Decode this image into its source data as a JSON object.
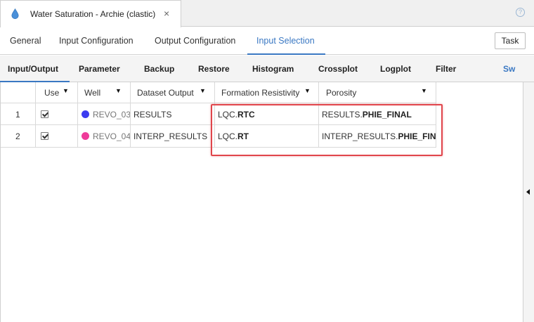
{
  "window": {
    "title": "Water Saturation - Archie (clastic)",
    "close_glyph": "×",
    "help_glyph": "?"
  },
  "main_tabs": [
    {
      "label": "General"
    },
    {
      "label": "Input Configuration"
    },
    {
      "label": "Output Configuration"
    },
    {
      "label": "Input Selection",
      "active": true
    }
  ],
  "task_button": "Task",
  "sub_tabs": [
    {
      "label": "Input/Output",
      "active": true
    },
    {
      "label": "Parameter"
    },
    {
      "label": "Backup"
    },
    {
      "label": "Restore"
    },
    {
      "label": "Histogram"
    },
    {
      "label": "Crossplot"
    },
    {
      "label": "Logplot"
    },
    {
      "label": "Filter"
    },
    {
      "label": "Sw"
    }
  ],
  "table": {
    "headers": {
      "use": "Use",
      "well": "Well",
      "dataset_output": "Dataset Output",
      "formation_resistivity": "Formation Resistivity",
      "porosity": "Porosity"
    },
    "rows": [
      {
        "index": "1",
        "use": true,
        "well": "REVO_03",
        "well_color": "#3c3cf0",
        "dataset_output": "RESULTS",
        "resistivity_prefix": "LQC.",
        "resistivity_curve": "RTC",
        "porosity_prefix": "RESULTS.",
        "porosity_curve": "PHIE_FINAL"
      },
      {
        "index": "2",
        "use": true,
        "well": "REVO_04",
        "well_color": "#ef3b9a",
        "dataset_output": "INTERP_RESULTS",
        "resistivity_prefix": "LQC.",
        "resistivity_curve": "RT",
        "porosity_prefix": "INTERP_RESULTS.",
        "porosity_curve": "PHIE_FINAL"
      }
    ]
  },
  "colors": {
    "accent": "#3a78c3",
    "highlight": "#e0454b"
  },
  "icons": {
    "window": "water-drop-icon",
    "help": "help-circle-icon",
    "collapse": "collapse-left-arrow-icon"
  }
}
